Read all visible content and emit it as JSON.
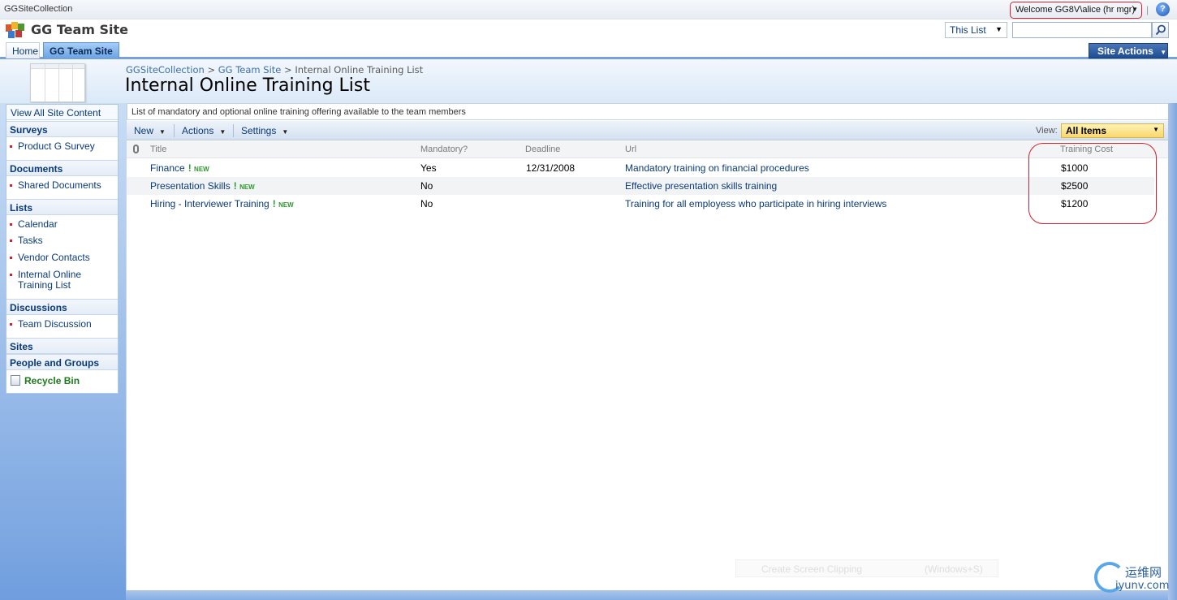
{
  "global": {
    "collection_name": "GGSiteCollection",
    "welcome_text": "Welcome GG8V\\alice (hr mgr)",
    "separator": "|",
    "help_icon": "?",
    "help_icon_name": "help-icon"
  },
  "header": {
    "site_title": "GG Team Site",
    "search_scope": "This List",
    "search_value": "",
    "logo_icon": "colored-tiles-logo-icon"
  },
  "tabs": [
    {
      "label": "Home",
      "selected": false
    },
    {
      "label": "GG Team Site",
      "selected": true
    }
  ],
  "site_actions_label": "Site Actions",
  "breadcrumb": {
    "items": [
      "GGSiteCollection",
      "GG Team Site",
      "Internal Online Training List"
    ],
    "separator": ">"
  },
  "page_title": "Internal Online Training List",
  "nav": {
    "view_all": "View All Site Content",
    "surveys": {
      "label": "Surveys",
      "items": [
        "Product G Survey"
      ]
    },
    "documents": {
      "label": "Documents",
      "items": [
        "Shared Documents"
      ]
    },
    "lists": {
      "label": "Lists",
      "items": [
        "Calendar",
        "Tasks",
        "Vendor Contacts",
        "Internal Online Training List"
      ]
    },
    "discussions": {
      "label": "Discussions",
      "items": [
        "Team Discussion"
      ]
    },
    "sites": "Sites",
    "people": "People and Groups",
    "recycle_bin": "Recycle Bin"
  },
  "list": {
    "description": "List of mandatory and optional online training offering available to the team members",
    "toolbar": {
      "new": "New",
      "actions": "Actions",
      "settings": "Settings"
    },
    "view_label": "View:",
    "view_value": "All Items",
    "columns": [
      "Title",
      "Mandatory?",
      "Deadline",
      "Url",
      "Training Cost"
    ],
    "new_flag": "!",
    "new_text": "NEW",
    "rows": [
      {
        "title": "Finance",
        "mandatory": "Yes",
        "deadline": "12/31/2008",
        "url": "Mandatory training on financial procedures",
        "cost": "$1000"
      },
      {
        "title": "Presentation Skills",
        "mandatory": "No",
        "deadline": "",
        "url": "Effective presentation skills training",
        "cost": "$2500"
      },
      {
        "title": "Hiring - Interviewer Training",
        "mandatory": "No",
        "deadline": "",
        "url": "Training for all employess who participate in hiring interviews",
        "cost": "$1200"
      }
    ]
  },
  "overlay": {
    "clip_label": "Create Screen Clipping",
    "clip_shortcut": "(Windows+S)"
  },
  "watermark": {
    "chinese": "运维网",
    "url": "iyunv.com"
  },
  "colors": {
    "highlight_red": "#d21f2f",
    "link_blue": "#0a3a7a",
    "new_green": "#2a9a2a",
    "view_yellow": "#f9d76b"
  }
}
